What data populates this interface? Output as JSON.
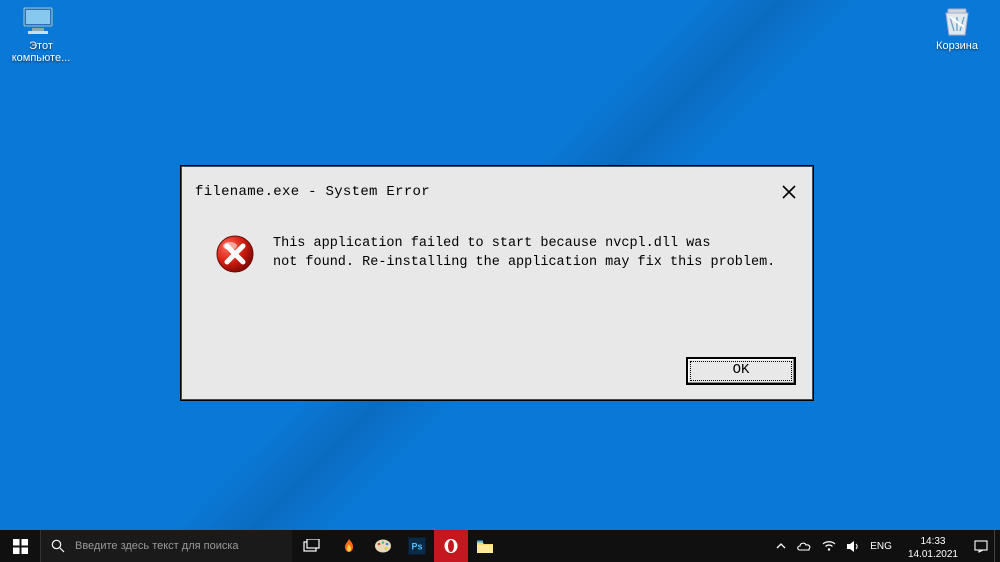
{
  "desktop": {
    "icons": [
      {
        "id": "this-pc",
        "label": "Этот\nкомпьюте..."
      },
      {
        "id": "recycle-bin",
        "label": "Корзина"
      }
    ]
  },
  "dialog": {
    "title": "filename.exe - System Error",
    "message": "This application failed to start because nvcpl.dll was\nnot found. Re-installing the application may fix this problem.",
    "ok_label": "OK"
  },
  "taskbar": {
    "search_placeholder": "Введите здесь текст для поиска",
    "tray": {
      "lang": "ENG",
      "time": "14:33",
      "date": "14.01.2021"
    }
  }
}
